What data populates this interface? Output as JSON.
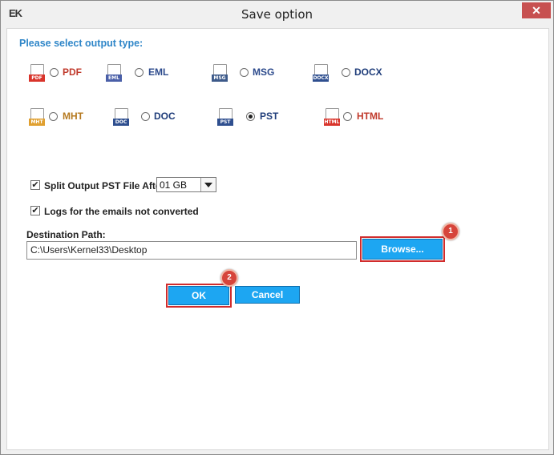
{
  "window": {
    "title": "Save option",
    "app_icon_text": "EK",
    "close_glyph": "✕"
  },
  "heading": "Please select output type:",
  "formats": [
    {
      "label": "PDF",
      "tag": "PDF",
      "color": "#c0392b",
      "tag_color": "#d9342b",
      "checked": false
    },
    {
      "label": "EML",
      "tag": "EML",
      "color": "#2c4a8c",
      "tag_color": "#4a5fa8",
      "checked": false
    },
    {
      "label": "MSG",
      "tag": "MSG",
      "color": "#2c4a8c",
      "tag_color": "#3d5a8a",
      "checked": false
    },
    {
      "label": "DOCX",
      "tag": "DOCX",
      "color": "#1f3d7a",
      "tag_color": "#2f4f8f",
      "checked": false
    },
    {
      "label": "MHT",
      "tag": "MHT",
      "color": "#b5791f",
      "tag_color": "#e0a030",
      "checked": false
    },
    {
      "label": "DOC",
      "tag": "DOC",
      "color": "#1f3d7a",
      "tag_color": "#2f4f8f",
      "checked": false
    },
    {
      "label": "PST",
      "tag": "PST",
      "color": "#1f3d7a",
      "tag_color": "#2f4f8f",
      "checked": true
    },
    {
      "label": "HTML",
      "tag": "HTML",
      "color": "#c0392b",
      "tag_color": "#d9342b",
      "checked": false
    }
  ],
  "split": {
    "checked": true,
    "label": "Split Output PST File After",
    "value": "01 GB"
  },
  "logs": {
    "checked": true,
    "label": "Logs for the emails not converted"
  },
  "destination": {
    "label": "Destination Path:",
    "value": "C:\\Users\\Kernel33\\Desktop",
    "browse_label": "Browse..."
  },
  "buttons": {
    "ok": "OK",
    "cancel": "Cancel"
  },
  "badges": {
    "browse": "1",
    "ok": "2"
  },
  "check_glyph": "✔"
}
